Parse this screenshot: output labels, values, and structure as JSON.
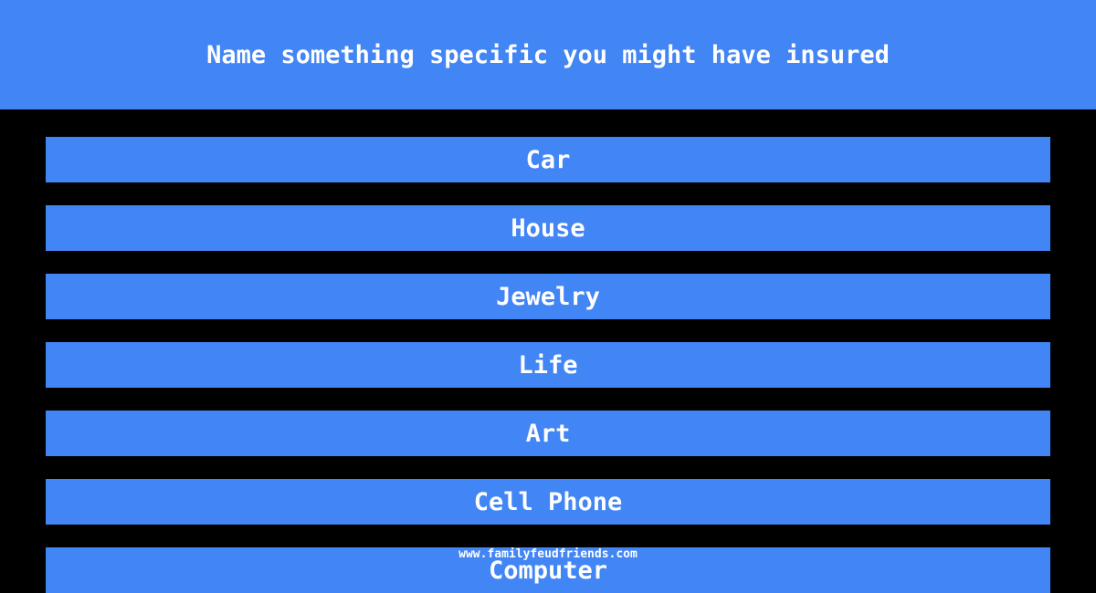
{
  "question": "Name something specific you might have insured",
  "answers": [
    "Car",
    "House",
    "Jewelry",
    "Life",
    "Art",
    "Cell Phone",
    "Computer"
  ],
  "watermark": "www.familyfeudfriends.com",
  "colors": {
    "accent": "#4285f4",
    "background": "#000000",
    "text": "#ffffff"
  }
}
